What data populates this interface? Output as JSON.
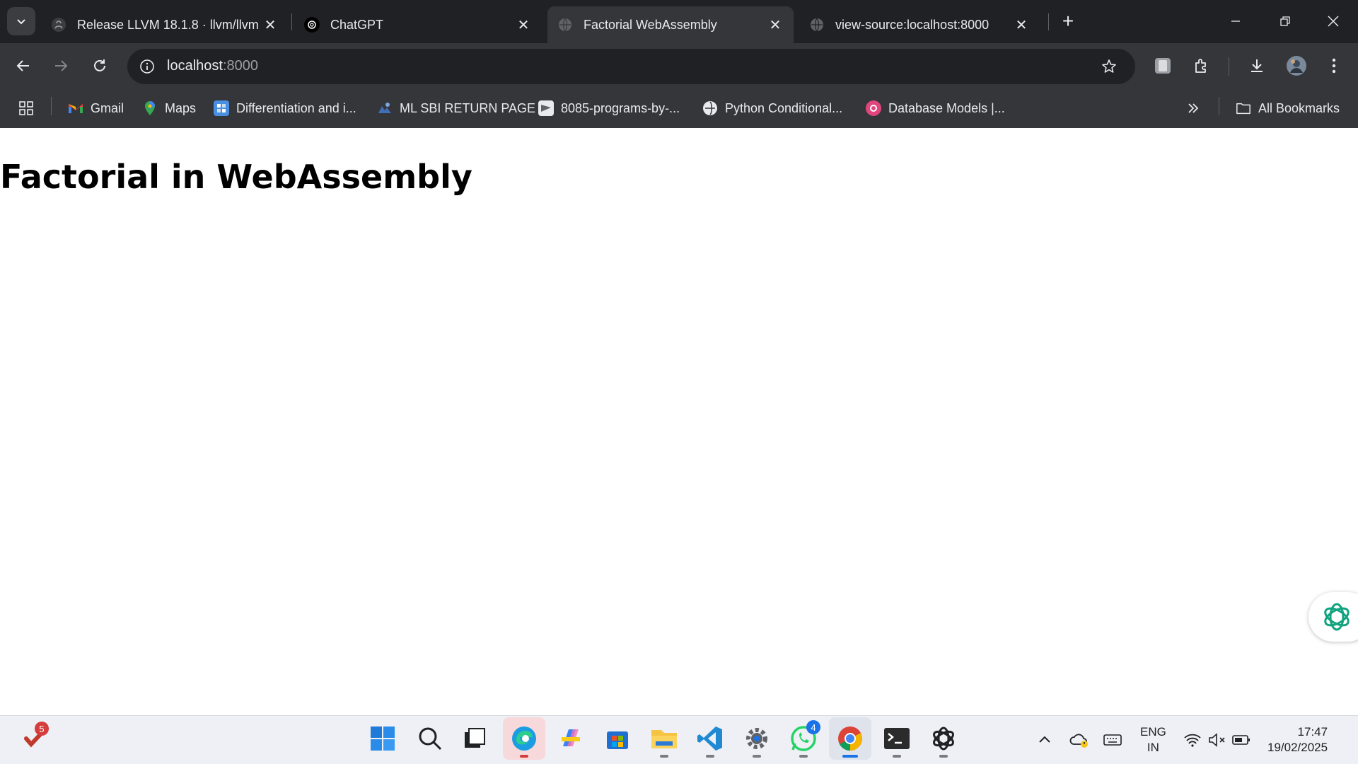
{
  "tabs": [
    {
      "label": "Release LLVM 18.1.8 · llvm/llvm",
      "icon": "github-icon",
      "active": false
    },
    {
      "label": "ChatGPT",
      "icon": "openai-icon",
      "active": false
    },
    {
      "label": "Factorial WebAssembly",
      "icon": "globe-icon",
      "active": true
    },
    {
      "label": "view-source:localhost:8000",
      "icon": "globe-icon",
      "active": false
    }
  ],
  "toolbar": {
    "url_host": "localhost",
    "url_port": ":8000"
  },
  "bookmarks": [
    {
      "label": "Gmail",
      "icon": "gmail-icon"
    },
    {
      "label": "Maps",
      "icon": "maps-icon"
    },
    {
      "label": "Differentiation and i...",
      "icon": "site-icon"
    },
    {
      "label": "ML SBI RETURN PAGE",
      "icon": "site-icon"
    },
    {
      "label": "8085-programs-by-...",
      "icon": "site-icon"
    },
    {
      "label": "Python Conditional...",
      "icon": "site-icon"
    },
    {
      "label": "Database Models |...",
      "icon": "site-icon"
    }
  ],
  "all_bookmarks_label": "All Bookmarks",
  "page": {
    "heading": "Factorial in WebAssembly"
  },
  "taskbar": {
    "todo_badge": "5",
    "whatsapp_badge": "4",
    "language": "ENG",
    "region": "IN",
    "time": "17:47",
    "date": "19/02/2025"
  },
  "colors": {
    "tabstrip": "#202124",
    "toolbar": "#35363a",
    "omnibox": "#202124",
    "taskbar": "#eef0f5"
  }
}
